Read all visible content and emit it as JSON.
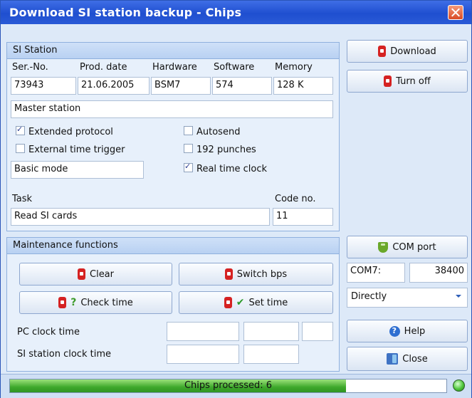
{
  "window": {
    "title": "Download SI station backup - Chips"
  },
  "si_station": {
    "header": "SI Station",
    "columns": {
      "serial": "Ser.-No.",
      "prod_date": "Prod. date",
      "hardware": "Hardware",
      "software": "Software",
      "memory": "Memory"
    },
    "values": {
      "serial": "73943",
      "prod_date": "21.06.2005",
      "hardware": "BSM7",
      "software": "574",
      "memory": "128 K"
    },
    "station_type": "Master station",
    "options": {
      "extended_protocol": {
        "label": "Extended protocol",
        "checked": true
      },
      "external_time_trigger": {
        "label": "External time trigger",
        "checked": false
      },
      "autosend": {
        "label": "Autosend",
        "checked": false
      },
      "punches_192": {
        "label": "192 punches",
        "checked": false
      },
      "real_time_clock": {
        "label": "Real time clock",
        "checked": true
      }
    },
    "mode": "Basic mode",
    "task_label": "Task",
    "task_value": "Read SI cards",
    "code_label": "Code no.",
    "code_value": "11"
  },
  "maintenance": {
    "header": "Maintenance functions",
    "clear": "Clear",
    "switch_bps": "Switch bps",
    "check_time": "Check time",
    "set_time": "Set time",
    "pc_clock_label": "PC clock time",
    "si_clock_label": "SI station clock time"
  },
  "sidebar": {
    "download": "Download",
    "turn_off": "Turn off",
    "com_port": "COM port",
    "port_name": "COM7:",
    "baud": "38400",
    "connection": "Directly",
    "help": "Help",
    "close": "Close"
  },
  "status": {
    "text": "Chips processed:  6",
    "progress": 0.77,
    "led_color": "#4ec63a"
  },
  "colors": {
    "title_bar": "#2a5ad6",
    "progress_fill": "#3ea82b"
  }
}
